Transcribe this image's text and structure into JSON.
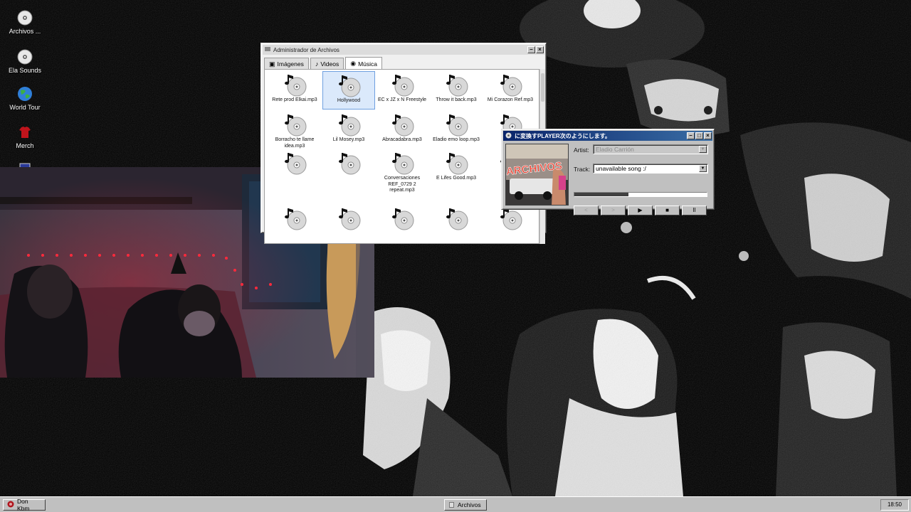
{
  "desktop": {
    "icons": [
      {
        "label": "Archivos ...",
        "icon": "cd-disc-icon"
      },
      {
        "label": "Ela Sounds",
        "icon": "cd-disc-icon"
      },
      {
        "label": "World Tour",
        "icon": "globe-icon"
      },
      {
        "label": "Merch",
        "icon": "tshirt-icon"
      },
      {
        "label": "",
        "icon": "computer-icon"
      }
    ]
  },
  "file_manager": {
    "title": "Administrador de Archivos",
    "tabs": [
      {
        "label": "Imágenes",
        "icon": "image-icon"
      },
      {
        "label": "Videos",
        "icon": "film-icon"
      },
      {
        "label": "Música",
        "icon": "music-icon"
      }
    ],
    "selected_tab": "Música",
    "files": [
      "Rete prod Elkai.mp3",
      "Hollywood",
      "EC x JZ x N Freestyle",
      "Throw it back.mp3",
      "Mi Corazon Ref.mp3",
      "Borracho te llame idea.mp3",
      "Lil Mosey.mp3",
      "Abracadabra.mp3",
      "Eladio emo loop.mp3",
      "Timb",
      "",
      "",
      "Conversaciones REF_0729 2 repeat.mp3",
      "E Lifes Good.mp3",
      "E M",
      "",
      "",
      "",
      "",
      ""
    ],
    "selected_file": "Hollywood"
  },
  "player": {
    "title": "に変換すPLAYER次のようにします。",
    "artist_label": "Artist:",
    "artist_value": "Eladio Carrión",
    "track_label": "Track:",
    "track_value": "unavailable song :/",
    "progress": 0.41,
    "album_art_text": "ARCHIVOS",
    "controls": [
      {
        "name": "prev-button",
        "label": "<"
      },
      {
        "name": "next-button",
        "label": ">"
      },
      {
        "name": "play-button",
        "label": "▶"
      },
      {
        "name": "stop-button",
        "label": "■"
      },
      {
        "name": "pause-button",
        "label": "II"
      }
    ]
  },
  "taskbar": {
    "start_label": "Don Kbm",
    "task_label": "Archivos",
    "clock": "18:50"
  },
  "colors": {
    "desktop": "#000000",
    "chrome": "#c0c0c0",
    "title_active": "#0a246a",
    "selection": "#dbe9fb"
  }
}
